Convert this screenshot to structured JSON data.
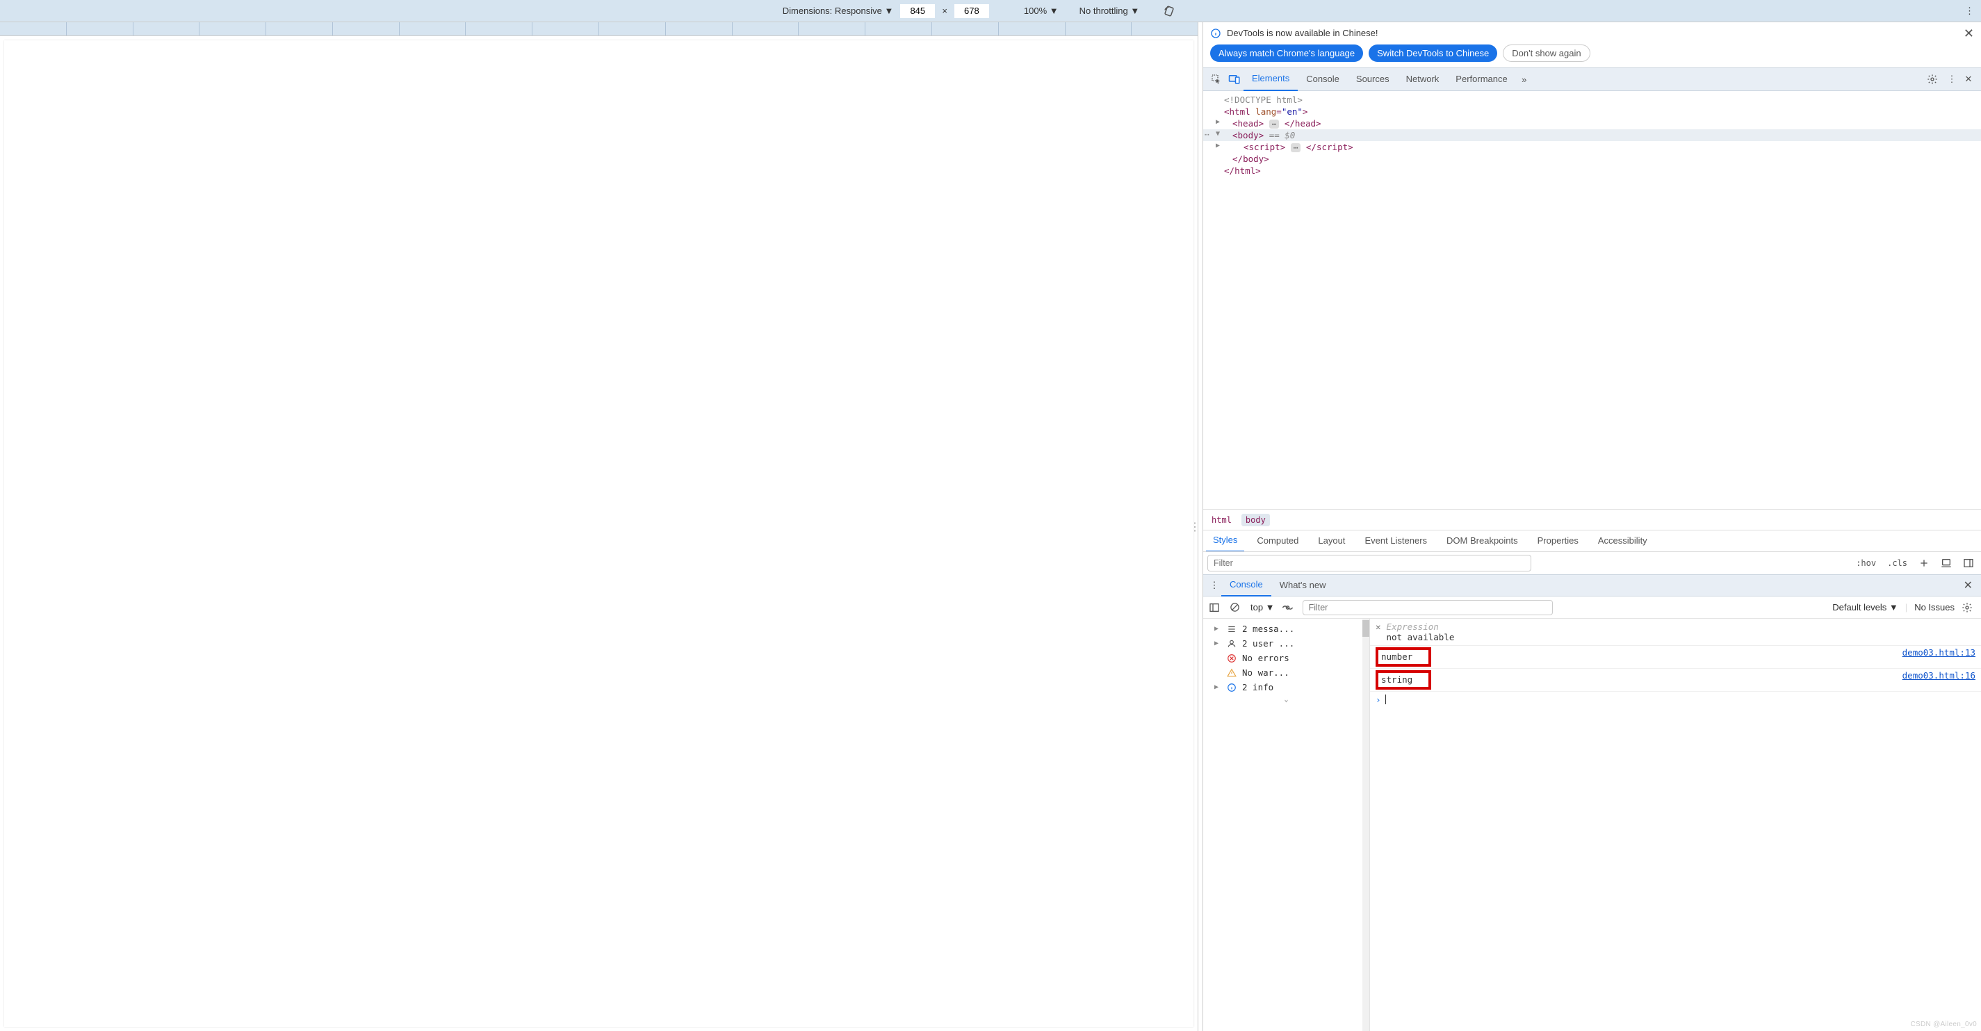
{
  "deviceToolbar": {
    "dimensionsLabel": "Dimensions: Responsive ▼",
    "width": "845",
    "height": "678",
    "x": "×",
    "zoom": "100% ▼",
    "throttling": "No throttling ▼"
  },
  "banner": {
    "text": "DevTools is now available in Chinese!",
    "btnMatch": "Always match Chrome's language",
    "btnSwitch": "Switch DevTools to Chinese",
    "btnDont": "Don't show again"
  },
  "mainTabs": {
    "elements": "Elements",
    "console": "Console",
    "sources": "Sources",
    "network": "Network",
    "performance": "Performance"
  },
  "dom": {
    "doctype": "<!DOCTYPE html>",
    "htmlOpen1": "html",
    "htmlLangAttr": "lang",
    "htmlLangVal": "\"en\"",
    "head": "head",
    "body": "body",
    "eq0": " == $0",
    "script": "script",
    "bodyClose": "body",
    "htmlClose": "html"
  },
  "breadcrumb": {
    "html": "html",
    "body": "body"
  },
  "stylesTabs": {
    "styles": "Styles",
    "computed": "Computed",
    "layout": "Layout",
    "eventListeners": "Event Listeners",
    "domBreakpoints": "DOM Breakpoints",
    "properties": "Properties",
    "accessibility": "Accessibility"
  },
  "stylesBar": {
    "filterPlaceholder": "Filter",
    "hov": ":hov",
    "cls": ".cls"
  },
  "drawerTabs": {
    "console": "Console",
    "whatsnew": "What's new"
  },
  "consoleToolbar": {
    "context": "top ▼",
    "filterPlaceholder": "Filter",
    "levels": "Default levels ▼",
    "issues": "No Issues"
  },
  "consoleSidebar": {
    "messages": "2 messa...",
    "user": "2 user ...",
    "errors": "No errors",
    "warnings": "No war...",
    "info": "2 info"
  },
  "liveExpr": {
    "placeholder": "Expression",
    "result": "not available"
  },
  "logs": {
    "r1val": "number",
    "r1src": "demo03.html:13",
    "r2val": "string",
    "r2src": "demo03.html:16"
  },
  "watermark": "CSDN @Aileen_0v0"
}
